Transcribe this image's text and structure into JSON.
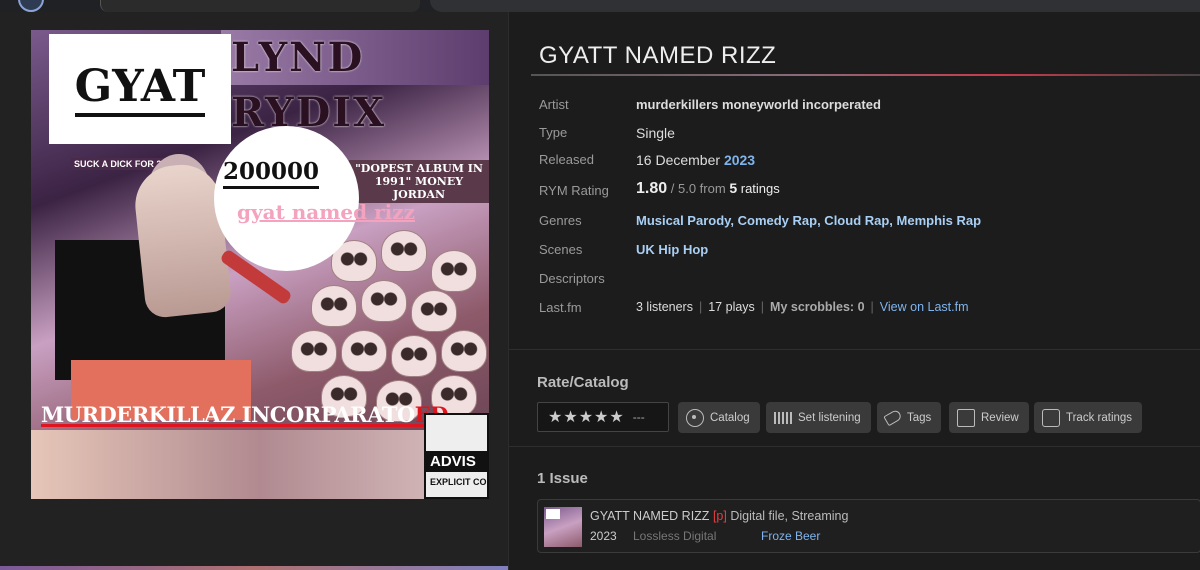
{
  "release": {
    "title": "GYATT NAMED RIZZ",
    "artist_label": "Artist",
    "artist": "murderkillers moneyworld incorperated",
    "type_label": "Type",
    "type": "Single",
    "released_label": "Released",
    "released_day": "16 December",
    "released_year": "2023",
    "rating_label": "RYM Rating",
    "rating": "1.80",
    "rating_max": "/ 5.0 from",
    "rating_count": "5",
    "rating_suffix": "ratings",
    "genres_label": "Genres",
    "genres": "Musical Parody, Comedy Rap, Cloud Rap, Memphis Rap",
    "scenes_label": "Scenes",
    "scenes": "UK Hip Hop",
    "descriptors_label": "Descriptors",
    "lastfm_label": "Last.fm",
    "listeners": "3 listeners",
    "plays": "17 plays",
    "scrobbles_label": "My scrobbles:",
    "scrobbles": "0",
    "lastfm_link": "View on Last.fm"
  },
  "cover": {
    "bg_title": "LYND RYDIX",
    "gyat": "GYAT",
    "count": "200000",
    "pink_text": "gyat named rizz",
    "blurb_left": "SUCK A DICK FOR 20",
    "quote": "\"DOPEST ALBUM IN 1991\" MONEY JORDAN",
    "banner_main": "MURDERKILLAZ INCORPARATO",
    "banner_red": "ED",
    "advisory_top": "ADVIS",
    "advisory_bottom": "EXPLICIT CO"
  },
  "rate": {
    "title": "Rate/Catalog",
    "stars": "★★★★★",
    "dashes": "---",
    "buttons": {
      "catalog": "Catalog",
      "listening": "Set listening",
      "tags": "Tags",
      "review": "Review",
      "tracks": "Track ratings"
    }
  },
  "issues": {
    "title": "1 Issue",
    "item": {
      "name": "GYATT NAMED RIZZ",
      "flag": "[p]",
      "format": "Digital file, Streaming",
      "year": "2023",
      "attrs": "Lossless Digital",
      "label": "Froze Beer"
    }
  },
  "colors": {
    "link": "#7fb4ee",
    "accent_red": "#e04040",
    "background": "#1c1c1c"
  }
}
